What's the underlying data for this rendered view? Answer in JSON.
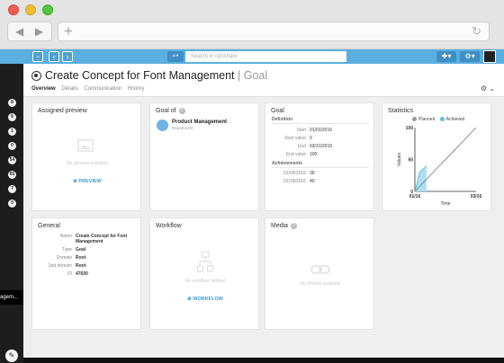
{
  "browser": {
    "back_icon": "triangle-left",
    "forward_icon": "triangle-right",
    "new_tab_icon": "plus",
    "reload_icon": "reload"
  },
  "toolbar": {
    "search_placeholder": "Search in censhare",
    "accent": "#5aaee0"
  },
  "rail": {
    "badges": [
      "8",
      "6",
      "1",
      "0",
      "54",
      "65",
      "7",
      "0"
    ],
    "tab_label": "agem..."
  },
  "header": {
    "title": "Create Concept for Font Management",
    "subtitle": "| Goal",
    "tabs": [
      "Overview",
      "Details",
      "Communication",
      "History"
    ],
    "active_tab": "Overview"
  },
  "cards": {
    "preview": {
      "title": "Assigned preview",
      "empty": "No preview available",
      "action": "PREVIEW"
    },
    "goal_of": {
      "title": "Goal of",
      "count": "1",
      "item_name": "Product Management",
      "item_type": "Department"
    },
    "goal": {
      "title": "Goal",
      "definition_heading": "Definition",
      "definition": [
        {
          "label": "Start",
          "value": "01/01/2016"
        },
        {
          "label": "Start value",
          "value": "0"
        },
        {
          "label": "End",
          "value": "03/31/2016"
        },
        {
          "label": "End value",
          "value": "100"
        }
      ],
      "achievements_heading": "Achievements",
      "achievements": [
        {
          "label": "01/08/2016",
          "value": "30"
        },
        {
          "label": "01/18/2016",
          "value": "40"
        }
      ]
    },
    "statistics": {
      "title": "Statistics",
      "legend_planned": "Planned",
      "legend_achieved": "Achieved",
      "ylabel": "Values",
      "xlabel": "Time",
      "yticks": [
        "100",
        "50",
        "0"
      ],
      "xtick_start": "01/16",
      "xtick_end": "03/16"
    },
    "general": {
      "title": "General",
      "rows": [
        {
          "label": "Name",
          "value": "Create Concept for Font Management"
        },
        {
          "label": "Type",
          "value": "Goal"
        },
        {
          "label": "Domain",
          "value": "Root"
        },
        {
          "label": "2nd domain",
          "value": "Root"
        },
        {
          "label": "ID",
          "value": "47600"
        }
      ]
    },
    "workflow": {
      "title": "Workflow",
      "empty": "No workflow defined",
      "action": "WORKFLOW"
    },
    "media": {
      "title": "Media",
      "count": "0",
      "empty": "No relation available"
    }
  },
  "chart_data": {
    "type": "line",
    "series": [
      {
        "name": "Planned",
        "x": [
          "01/01/2016",
          "03/31/2016"
        ],
        "values": [
          0,
          100
        ],
        "color": "#777777"
      },
      {
        "name": "Achieved",
        "x": [
          "01/01/2016",
          "01/08/2016",
          "01/18/2016"
        ],
        "values": [
          0,
          30,
          40
        ],
        "color": "#5fbfe6"
      }
    ],
    "title": "",
    "xlabel": "Time",
    "ylabel": "Values",
    "ylim": [
      0,
      100
    ],
    "xticks": [
      "01/16",
      "03/16"
    ],
    "yticks": [
      0,
      50,
      100
    ],
    "legend": "top"
  }
}
